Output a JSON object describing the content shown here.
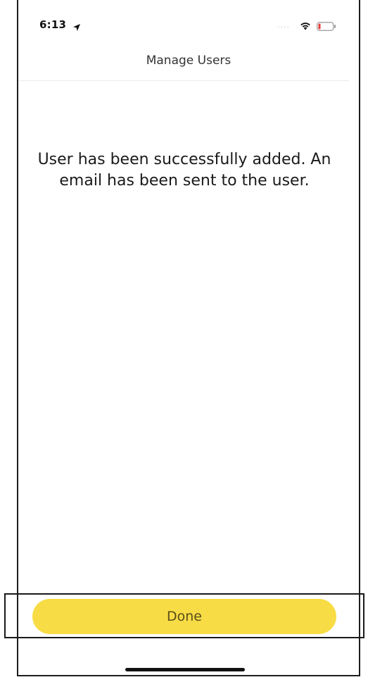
{
  "status_bar": {
    "time": "6:13",
    "location_icon": "location-arrow-icon",
    "signal_text": "....",
    "wifi_icon": "wifi-icon",
    "battery_icon": "battery-low-icon",
    "battery_color": "#e53935"
  },
  "header": {
    "title": "Manage Users"
  },
  "main": {
    "message": "User has been successfully added. An email has been sent to the user."
  },
  "footer": {
    "done_label": "Done",
    "done_color": "#f8dc45"
  }
}
